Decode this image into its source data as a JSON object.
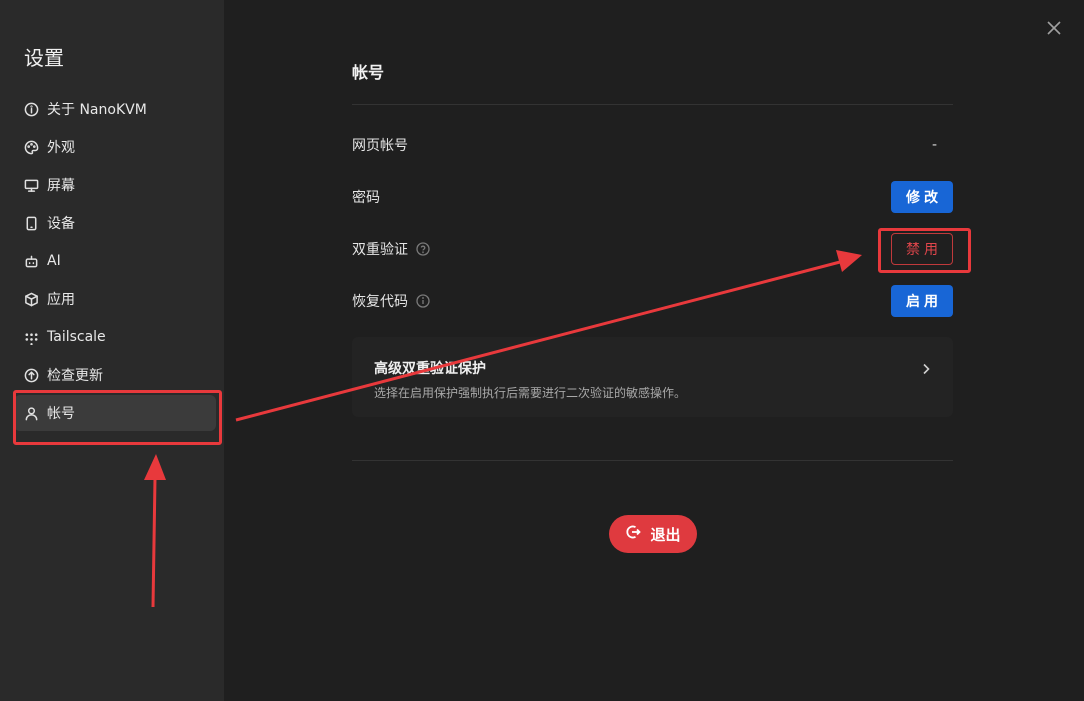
{
  "sidebar": {
    "title": "设置",
    "items": [
      {
        "label": "关于 NanoKVM",
        "icon": "info-icon"
      },
      {
        "label": "外观",
        "icon": "palette-icon"
      },
      {
        "label": "屏幕",
        "icon": "monitor-icon"
      },
      {
        "label": "设备",
        "icon": "device-icon"
      },
      {
        "label": "AI",
        "icon": "robot-icon"
      },
      {
        "label": "应用",
        "icon": "package-icon"
      },
      {
        "label": "Tailscale",
        "icon": "tailscale-icon"
      },
      {
        "label": "检查更新",
        "icon": "update-icon"
      },
      {
        "label": "帐号",
        "icon": "user-icon",
        "active": true
      }
    ]
  },
  "main": {
    "title": "帐号",
    "rows": {
      "web_account": {
        "label": "网页帐号",
        "value": "-"
      },
      "password": {
        "label": "密码",
        "button": "修改"
      },
      "two_factor": {
        "label": "双重验证",
        "button": "禁用",
        "icon": "help-icon"
      },
      "recovery_code": {
        "label": "恢复代码",
        "button": "启用",
        "icon": "info-icon"
      }
    },
    "advanced": {
      "title": "高级双重验证保护",
      "description": "选择在启用保护强制执行后需要进行二次验证的敏感操作。",
      "icon": "chevron-right-icon"
    },
    "logout": {
      "label": "退出",
      "icon": "logout-icon"
    }
  },
  "colors": {
    "accent_blue": "#1866d6",
    "danger_red": "#df3a3f",
    "annotation_red": "#e8393c"
  }
}
